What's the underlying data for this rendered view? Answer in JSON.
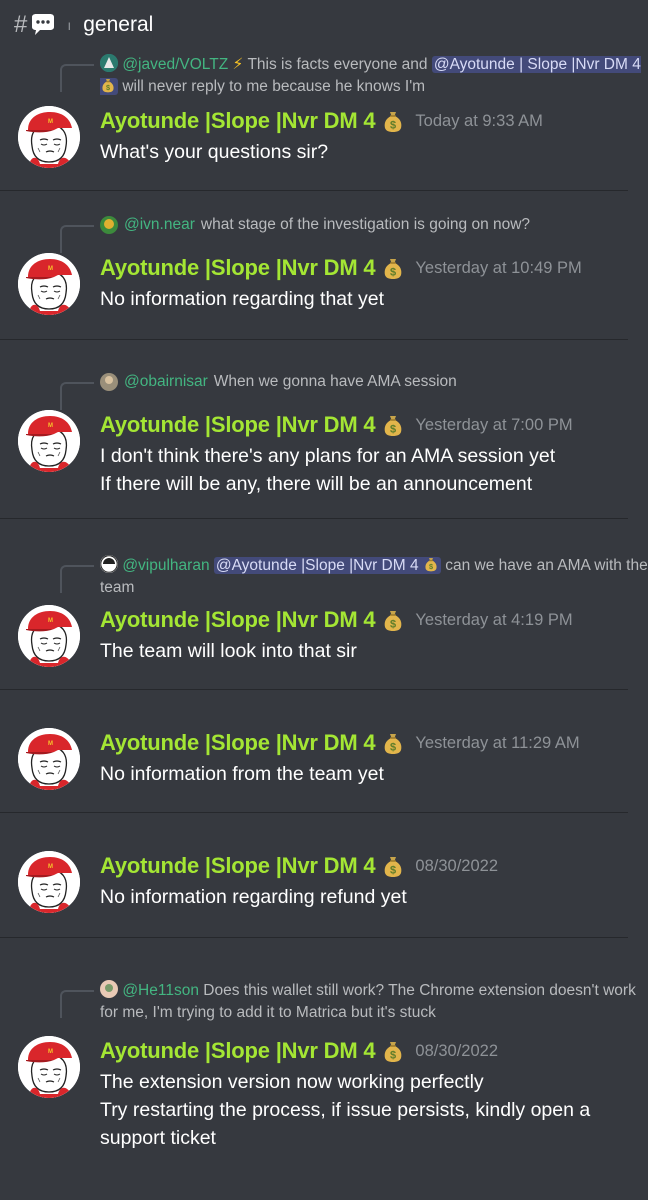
{
  "channel": {
    "hash": "#",
    "icon": "speech-bubble-icon",
    "name": "general"
  },
  "author": {
    "name": "Ayotunde |Slope |Nvr DM 4",
    "badge": "money-bag-emoji",
    "color": "#a4e634"
  },
  "messages": [
    {
      "reply": {
        "name": "@javed/VOLTZ",
        "emoji": "⚡",
        "text": "This is facts everyone and",
        "mention": "@Ayotunde | Slope |Nvr DM 4",
        "after": "will never reply to me because he knows I'm"
      },
      "timestamp": "Today at 9:33 AM",
      "lines": [
        "What's your questions sir?"
      ]
    },
    {
      "reply": {
        "name": "@ivn.near",
        "text": "what stage of the investigation is going on now?"
      },
      "timestamp": "Yesterday at 10:49 PM",
      "lines": [
        "No information regarding that yet"
      ]
    },
    {
      "reply": {
        "name": "@obairnisar",
        "text": "When we gonna have AMA session"
      },
      "timestamp": "Yesterday at 7:00 PM",
      "lines": [
        "I don't think there's any plans for an AMA session yet",
        "If there will be any, there will be an announcement"
      ]
    },
    {
      "reply": {
        "name": "@vipulharan",
        "mention": "@Ayotunde |Slope |Nvr DM 4",
        "text": "can we have an AMA with the team"
      },
      "timestamp": "Yesterday at 4:19 PM",
      "lines": [
        "The team will look into that sir"
      ]
    },
    {
      "timestamp": "Yesterday at 11:29 AM",
      "lines": [
        "No information from the team yet"
      ]
    },
    {
      "timestamp": "08/30/2022",
      "lines": [
        "No information regarding refund yet"
      ]
    },
    {
      "reply": {
        "name": "@He11son",
        "text": "Does this wallet still work? The Chrome extension doesn't work for me, I'm trying to add it to Matrica but it's stuck"
      },
      "timestamp": "08/30/2022",
      "lines": [
        "The extension version now working perfectly",
        "Try restarting the process, if issue persists, kindly open a support ticket"
      ]
    }
  ]
}
